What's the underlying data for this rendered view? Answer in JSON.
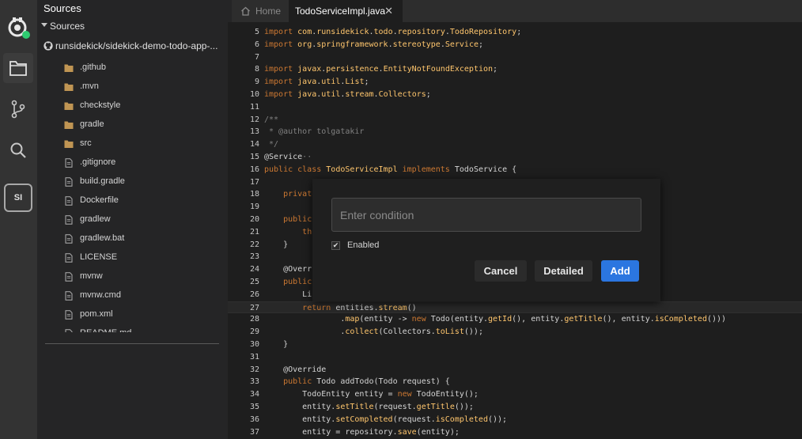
{
  "sidebar": {
    "title": "Sources",
    "section_label": "Sources",
    "repo_label": "runsidekick/sidekick-demo-todo-app-...",
    "items": [
      {
        "name": ".github",
        "type": "folder"
      },
      {
        "name": ".mvn",
        "type": "folder"
      },
      {
        "name": "checkstyle",
        "type": "folder"
      },
      {
        "name": "gradle",
        "type": "folder"
      },
      {
        "name": "src",
        "type": "folder"
      },
      {
        "name": ".gitignore",
        "type": "file"
      },
      {
        "name": "build.gradle",
        "type": "file"
      },
      {
        "name": "Dockerfile",
        "type": "file"
      },
      {
        "name": "gradlew",
        "type": "file"
      },
      {
        "name": "gradlew.bat",
        "type": "file"
      },
      {
        "name": "LICENSE",
        "type": "file"
      },
      {
        "name": "mvnw",
        "type": "file"
      },
      {
        "name": "mvnw.cmd",
        "type": "file"
      },
      {
        "name": "pom.xml",
        "type": "file"
      },
      {
        "name": "README.md",
        "type": "file"
      }
    ]
  },
  "activity": {
    "user_badge": "SI"
  },
  "tabs": {
    "home_label": "Home",
    "file_label": "TodoServiceImpl.java",
    "close_glyph": "✕"
  },
  "editor": {
    "lines": [
      {
        "num": "5",
        "code": "<span class=\"kw\">import</span> <span class=\"pk\">com</span>.<span class=\"pk\">runsidekick</span>.<span class=\"pk\">todo</span>.<span class=\"pk\">repository</span>.<span class=\"pk\">TodoRepository</span>;"
      },
      {
        "num": "6",
        "code": "<span class=\"kw\">import</span> <span class=\"pk\">org</span>.<span class=\"pk\">springframework</span>.<span class=\"pk\">stereotype</span>.<span class=\"pk\">Service</span>;"
      },
      {
        "num": "7",
        "code": ""
      },
      {
        "num": "8",
        "code": "<span class=\"kw\">import</span> <span class=\"pk\">javax</span>.<span class=\"pk\">persistence</span>.<span class=\"pk\">EntityNotFoundException</span>;"
      },
      {
        "num": "9",
        "code": "<span class=\"kw\">import</span> <span class=\"pk\">java</span>.<span class=\"pk\">util</span>.<span class=\"pk\">List</span>;"
      },
      {
        "num": "10",
        "code": "<span class=\"kw\">import</span> <span class=\"pk\">java</span>.<span class=\"pk\">util</span>.<span class=\"pk\">stream</span>.<span class=\"pk\">Collectors</span>;"
      },
      {
        "num": "11",
        "code": ""
      },
      {
        "num": "12",
        "code": "<span class=\"cm\">/**</span>"
      },
      {
        "num": "13",
        "code": "<span class=\"cm\"> * @author tolgatakir</span>"
      },
      {
        "num": "14",
        "code": "<span class=\"cm\"> */</span>"
      },
      {
        "num": "15",
        "code": "<span class=\"plain\">@Service</span><span class=\"cm\">··</span>"
      },
      {
        "num": "16",
        "code": "<span class=\"kw\">public class</span> <span class=\"pk\">TodoServiceImpl</span> <span class=\"kw\">implements</span> TodoService {"
      },
      {
        "num": "17",
        "code": ""
      },
      {
        "num": "18",
        "code": "    <span class=\"kw\">private</span>"
      },
      {
        "num": "19",
        "code": ""
      },
      {
        "num": "20",
        "code": "    <span class=\"kw\">public</span>"
      },
      {
        "num": "21",
        "code": "        <span class=\"kw\">th</span>"
      },
      {
        "num": "22",
        "code": "    }"
      },
      {
        "num": "23",
        "code": ""
      },
      {
        "num": "24",
        "code": "    @Overr"
      },
      {
        "num": "25",
        "code": "    <span class=\"kw\">public</span>"
      },
      {
        "num": "26",
        "code": "        Li"
      },
      {
        "num": "27",
        "code": "        <span class=\"kw\">return</span> entities.<span class=\"mt\">stream</span>()"
      },
      {
        "num": "28",
        "code": "                .<span class=\"mt\">map</span>(entity -> <span class=\"kw\">new</span> Todo(entity.<span class=\"mt\">getId</span>(), entity.<span class=\"mt\">getTitle</span>(), entity.<span class=\"mt\">isCompleted</span>()))"
      },
      {
        "num": "29",
        "code": "                .<span class=\"mt\">collect</span>(Collectors.<span class=\"mt\">toList</span>());"
      },
      {
        "num": "30",
        "code": "    }"
      },
      {
        "num": "31",
        "code": ""
      },
      {
        "num": "32",
        "code": "    @Override"
      },
      {
        "num": "33",
        "code": "    <span class=\"kw\">public</span> Todo addTodo(Todo request) {"
      },
      {
        "num": "34",
        "code": "        TodoEntity entity = <span class=\"kw\">new</span> TodoEntity();"
      },
      {
        "num": "35",
        "code": "        entity.<span class=\"mt\">setTitle</span>(request.<span class=\"mt\">getTitle</span>());"
      },
      {
        "num": "36",
        "code": "        entity.<span class=\"mt\">setCompleted</span>(request.<span class=\"mt\">isCompleted</span>());"
      },
      {
        "num": "37",
        "code": "        entity = repository.<span class=\"mt\">save</span>(entity);"
      }
    ],
    "active_line": "27"
  },
  "popup": {
    "condition_placeholder": "Enter condition",
    "condition_value": "",
    "enabled_label": "Enabled",
    "enabled_checked": true,
    "cancel_label": "Cancel",
    "detailed_label": "Detailed",
    "add_label": "Add",
    "accent_color": "#2b76e0"
  }
}
